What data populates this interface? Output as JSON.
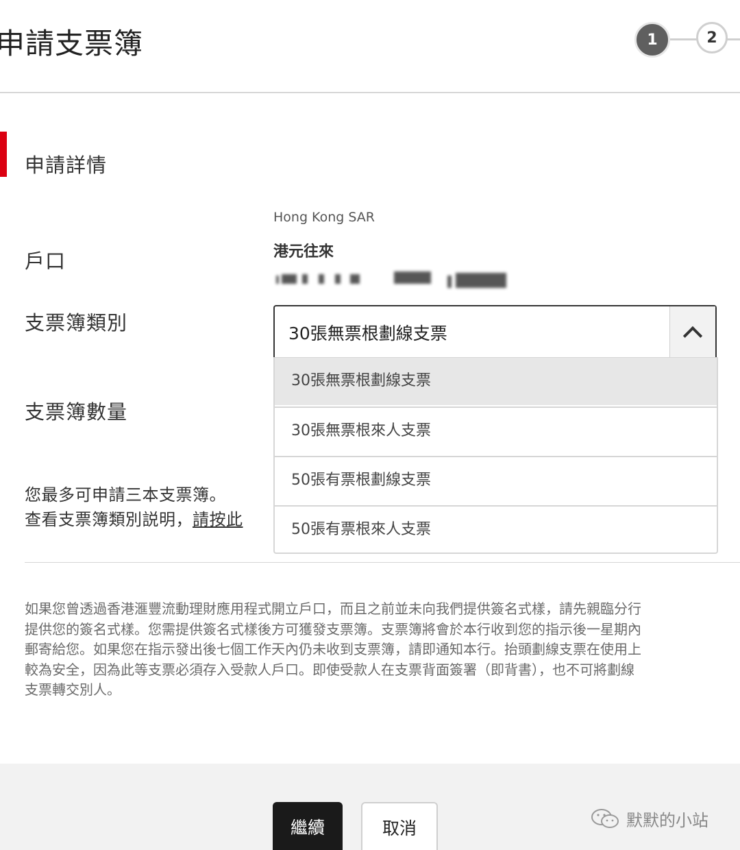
{
  "header": {
    "title": "申請支票簿",
    "steps": [
      {
        "label": "1",
        "state": "active"
      },
      {
        "label": "2",
        "state": "inactive"
      }
    ]
  },
  "section": {
    "title": "申請詳情"
  },
  "form": {
    "account_label": "戶口",
    "account_region": "Hong Kong SAR",
    "account_type": "港元往來",
    "chequebook_type_label": "支票簿類別",
    "chequebook_quantity_label": "支票簿數量",
    "selected_type": "30張無票根劃線支票",
    "type_options": [
      "30張無票根劃線支票",
      "30張無票根來人支票",
      "50張有票根劃線支票",
      "50張有票根來人支票"
    ],
    "selected_index": 0
  },
  "hint": {
    "max_text": "您最多可申請三本支票簿。",
    "explain_prefix": "查看支票簿類別説明，",
    "explain_link": "請按此"
  },
  "notice": {
    "lines": [
      "如果您曾透過香港滙豐流動理財應用程式開立戶口，而且之前並未向我們提供簽名式樣，請先親臨分行",
      "提供您的簽名式樣。您需提供簽名式樣後方可獲發支票簿。支票簿將會於本行收到您的指示後一星期內",
      "郵寄給您。如果您在指示發出後七個工作天內仍未收到支票簿，請即通知本行。抬頭劃線支票在使用上",
      "較為安全，因為此等支票必須存入受款人戶口。即使受款人在支票背面簽署（即背書），也不可將劃線",
      "支票轉交別人。"
    ]
  },
  "footer": {
    "continue_label": "繼續",
    "cancel_label": "取消",
    "watermark_text": "默默的小站"
  },
  "colors": {
    "accent_red": "#db0011",
    "primary_button": "#1a1a1a",
    "step_active": "#5f5f5f"
  }
}
